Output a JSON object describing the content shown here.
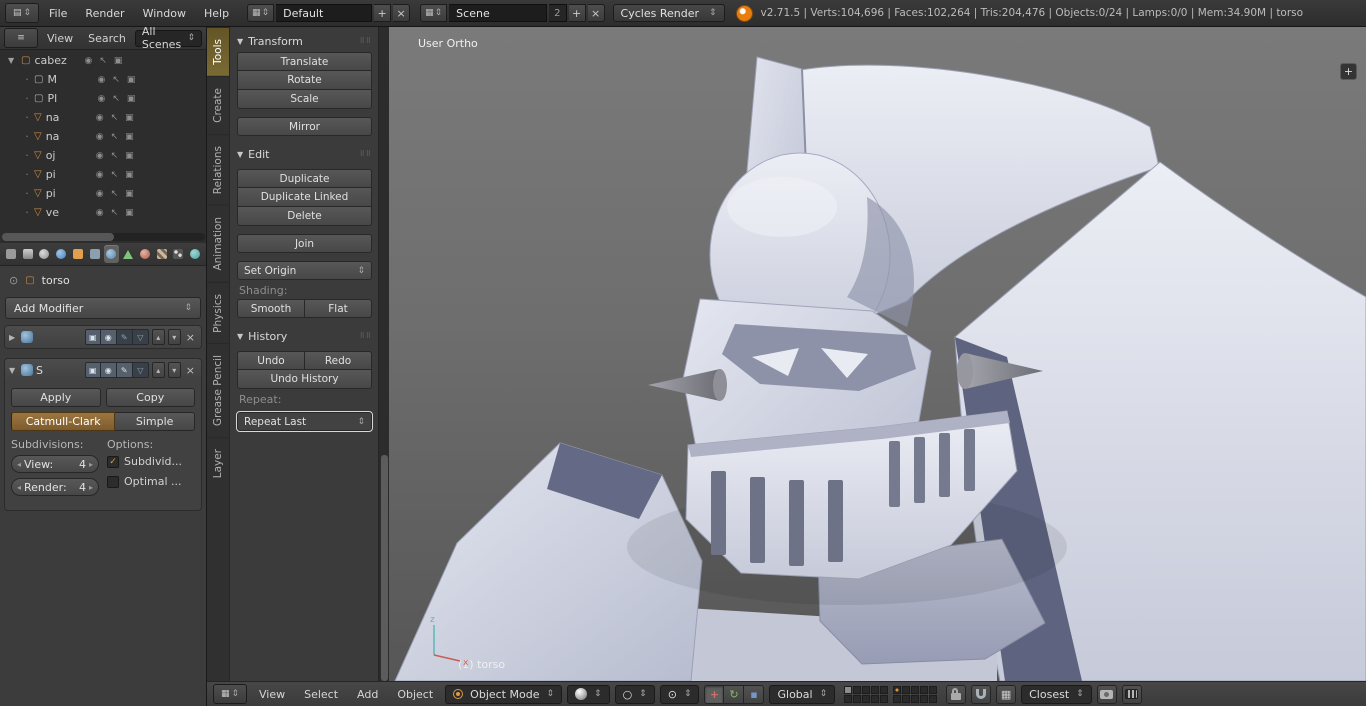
{
  "colors": {
    "accent_orange": "#e87d0d",
    "active_tab_amber": "#6e5f2f",
    "active_toggle_amber": "#8d6839",
    "checkbox_check": "#e8962e",
    "viewport_top": "#7a7a7a",
    "viewport_bottom": "#565656",
    "model_light": "#dfe2ec",
    "model_navy": "#5e6380"
  },
  "icons": {
    "updown": "⇕",
    "plus": "+",
    "close": "×",
    "collapse": "▼",
    "expand": "▶",
    "grip": "⠿⠿",
    "eye": "◉",
    "cursor": "↖",
    "camera": "▣",
    "mesh": "▽",
    "object": "▢",
    "pin": "⊙",
    "pivot": "⊙",
    "left": "◂",
    "right": "▸",
    "up": "▴",
    "down": "▾",
    "check": "✓",
    "pencil": "✎",
    "dot": "·",
    "menu": "≡",
    "editor": "▤",
    "screen": "▦",
    "rotate": "↻",
    "move": "+",
    "scale": "▪",
    "circle": "○"
  },
  "info_bar": {
    "menus": [
      {
        "label": "File"
      },
      {
        "label": "Render"
      },
      {
        "label": "Window"
      },
      {
        "label": "Help"
      }
    ],
    "layout": {
      "value": "Default"
    },
    "scene": {
      "value": "Scene",
      "users": "2"
    },
    "engine": {
      "value": "Cycles Render"
    },
    "stats": "v2.71.5 | Verts:104,696 | Faces:102,264 | Tris:204,476 | Objects:0/24 | Lamps:0/0 | Mem:34.90M | torso"
  },
  "outliner": {
    "tabs": [
      {
        "label": "View"
      },
      {
        "label": "Search"
      },
      {
        "label": "All Scenes"
      }
    ],
    "items": [
      {
        "label": "cabez"
      },
      {
        "label": "M"
      },
      {
        "label": "Pl"
      },
      {
        "label": "na"
      },
      {
        "label": "na"
      },
      {
        "label": "oj"
      },
      {
        "label": "pi"
      },
      {
        "label": "pi"
      },
      {
        "label": "ve"
      }
    ]
  },
  "properties": {
    "context_object": "torso",
    "add_modifier": "Add Modifier",
    "modifier2_name": "S",
    "subsurf": {
      "apply": "Apply",
      "copy": "Copy",
      "catmull_clark": "Catmull-Clark",
      "simple": "Simple",
      "subdivisions_label": "Subdivisions:",
      "options_label": "Options:",
      "view_label": "View:",
      "view_value": "4",
      "render_label": "Render:",
      "render_value": "4",
      "subdivide_uvs_label": "Subdivid...",
      "optimal_display_label": "Optimal ..."
    }
  },
  "tool_shelf": {
    "tabs": [
      {
        "label": "Tools"
      },
      {
        "label": "Create"
      },
      {
        "label": "Relations"
      },
      {
        "label": "Animation"
      },
      {
        "label": "Physics"
      },
      {
        "label": "Grease Pencil"
      },
      {
        "label": "Layer"
      }
    ],
    "transform_panel": {
      "title": "Transform",
      "translate": "Translate",
      "rotate": "Rotate",
      "scale": "Scale",
      "mirror": "Mirror"
    },
    "edit_panel": {
      "title": "Edit",
      "duplicate": "Duplicate",
      "duplicate_linked": "Duplicate Linked",
      "delete": "Delete",
      "join": "Join",
      "set_origin": "Set Origin",
      "shading_label": "Shading:",
      "smooth": "Smooth",
      "flat": "Flat"
    },
    "history_panel": {
      "title": "History",
      "undo": "Undo",
      "redo": "Redo",
      "undo_history": "Undo History",
      "repeat_label": "Repeat:",
      "repeat_last": "Repeat Last"
    }
  },
  "viewport": {
    "view_name": "User Ortho",
    "active_object": "(1) torso",
    "axis_x": "x",
    "axis_z": "z"
  },
  "view_header": {
    "menus": [
      {
        "label": "View"
      },
      {
        "label": "Select"
      },
      {
        "label": "Add"
      },
      {
        "label": "Object"
      }
    ],
    "mode": "Object Mode",
    "orientation": "Global",
    "snap_target": "Closest"
  }
}
